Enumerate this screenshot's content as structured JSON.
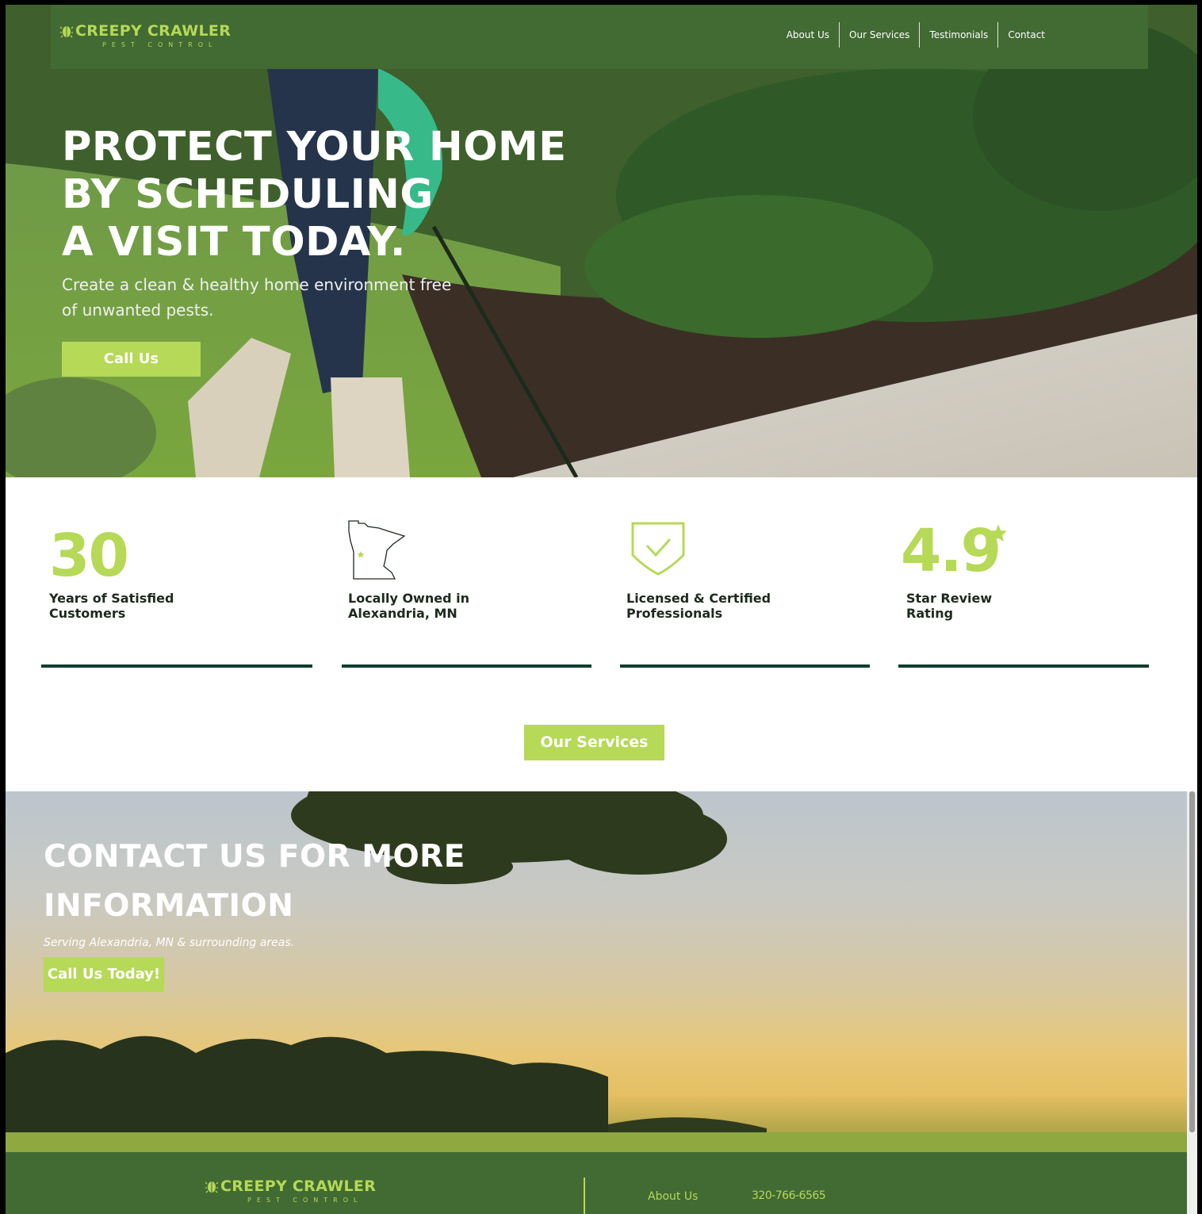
{
  "brand": {
    "name": "CREEPY CRAWLER",
    "tagline": "PEST CONTROL",
    "icon": "bug-icon"
  },
  "nav": {
    "items": [
      "About Us",
      "Our Services",
      "Testimonials",
      "Contact"
    ]
  },
  "hero": {
    "headline_lines": [
      "PROTECT YOUR HOME",
      "BY SCHEDULING",
      "A VISIT TODAY."
    ],
    "lead": "Create a clean & healthy home environment free of unwanted pests.",
    "cta": "Call Us"
  },
  "stats": [
    {
      "value": "30",
      "label": "Years of Satisfied\nCustomers"
    },
    {
      "icon": "minnesota-map-icon",
      "label": "Locally Owned in\nAlexandria, MN"
    },
    {
      "icon": "shield-check-icon",
      "label": "Licensed & Certified\nProfessionals"
    },
    {
      "value": "4.9",
      "icon": "star-icon",
      "label": "Star Review\nRating"
    }
  ],
  "services_cta": "Our Services",
  "contact": {
    "heading_lines": [
      "CONTACT US FOR MORE",
      "INFORMATION"
    ],
    "serving": "Serving Alexandria, MN & surrounding areas.",
    "cta": "Call Us Today!"
  },
  "footer": {
    "link": "About Us",
    "phone": "320-766-6565"
  },
  "colors": {
    "brand_green": "#426a33",
    "accent_lime": "#b6d957",
    "rule_dark": "#0f3d2e"
  }
}
